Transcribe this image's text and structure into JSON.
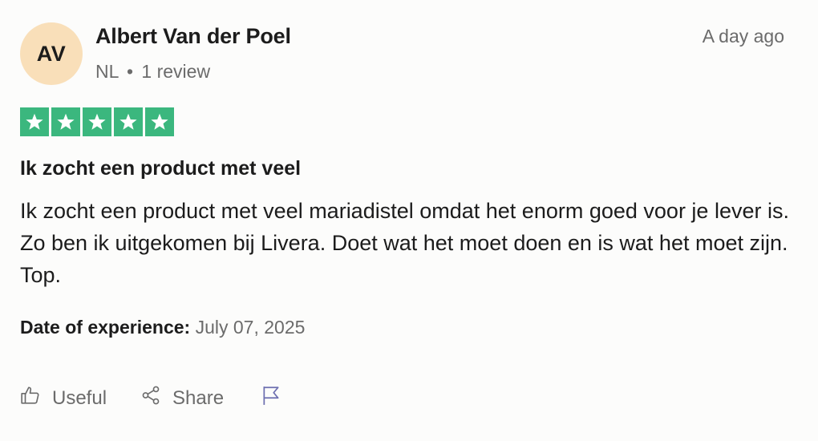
{
  "review": {
    "author": {
      "initials": "AV",
      "name": "Albert Van der Poel",
      "country": "NL",
      "separator": "•",
      "review_count": "1 review"
    },
    "timestamp": "A day ago",
    "rating": 5,
    "rating_max": 5,
    "title": "Ik zocht een product met veel",
    "body": "Ik zocht een product met veel mariadistel omdat het enorm goed voor je lever is. Zo ben ik uitgekomen bij Livera. Doet wat het moet doen en is wat het moet zijn. Top.",
    "experience": {
      "label": "Date of experience:",
      "date": "July 07, 2025"
    }
  },
  "actions": {
    "useful_label": "Useful",
    "share_label": "Share"
  },
  "icons": {
    "useful": "thumbs-up-icon",
    "share": "share-icon",
    "report": "flag-icon",
    "star": "star-icon"
  },
  "colors": {
    "star_bg": "#3bb77e",
    "avatar_bg": "#f9dfb9",
    "muted_text": "#6b6b6b",
    "flag": "#6d6fb0"
  }
}
